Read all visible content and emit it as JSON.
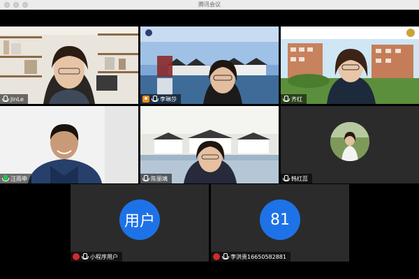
{
  "window": {
    "title": "腾讯会议"
  },
  "participants": [
    {
      "name": "JinLe"
    },
    {
      "name": "李琳莎"
    },
    {
      "name": "齐红"
    },
    {
      "name": "汪雨申"
    },
    {
      "name": "陈丽璃"
    },
    {
      "name": "韩红蕊"
    },
    {
      "name": "小程序用户",
      "avatar_text": "用户"
    },
    {
      "name": "李洪贵16650582881",
      "avatar_text": "81"
    }
  ],
  "colors": {
    "avatar_blue": "#1e72e8",
    "speaking_green": "#28c24a",
    "host_orange": "#f08a1c"
  }
}
